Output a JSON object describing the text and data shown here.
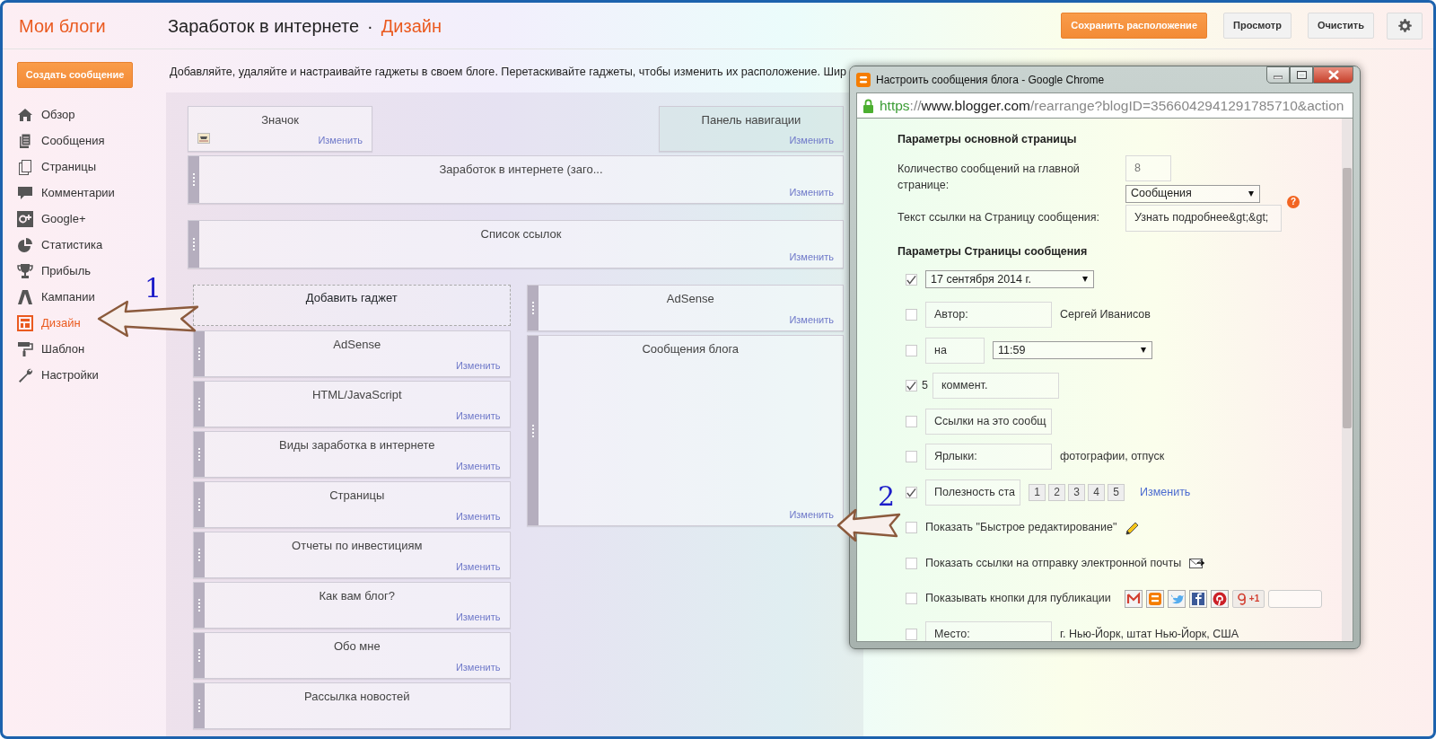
{
  "header": {
    "blogs_link": "Мои блоги",
    "blog_title": "Заработок в интернете",
    "separator": "·",
    "section": "Дизайн",
    "buttons": [
      {
        "label": "Сохранить расположение",
        "kind": "primary"
      },
      {
        "label": "Просмотр",
        "kind": "default"
      },
      {
        "label": "Очистить",
        "kind": "default"
      }
    ]
  },
  "sidebar": {
    "create_button": "Создать сообщение",
    "items": [
      {
        "label": "Обзор",
        "selected": false
      },
      {
        "label": "Сообщения",
        "selected": false
      },
      {
        "label": "Страницы",
        "selected": false
      },
      {
        "label": "Комментарии",
        "selected": false
      },
      {
        "label": "Google+",
        "selected": false
      },
      {
        "label": "Статистика",
        "selected": false
      },
      {
        "label": "Прибыль",
        "selected": false
      },
      {
        "label": "Кампании",
        "selected": false
      },
      {
        "label": "Дизайн",
        "selected": true
      },
      {
        "label": "Шаблон",
        "selected": false
      },
      {
        "label": "Настройки",
        "selected": false
      }
    ]
  },
  "description": "Добавляйте, удаляйте и настраивайте гаджеты в своем блоге. Перетаскивайте гаджеты, чтобы изменить их расположение. Шир",
  "layout": {
    "header_row": [
      {
        "title": "Значок",
        "edit": "Изменить",
        "kind": "favicon"
      },
      {
        "title": "Панель навигации",
        "edit": "Изменить",
        "kind": "navbar"
      }
    ],
    "wide": [
      {
        "title": "Заработок в интернете (заго...",
        "edit": "Изменить"
      },
      {
        "title": "Список ссылок",
        "edit": "Изменить"
      }
    ],
    "add_gadget": "Добавить гаджет",
    "left_column": [
      {
        "title": "AdSense",
        "edit": "Изменить"
      },
      {
        "title": "HTML/JavaScript",
        "edit": "Изменить"
      },
      {
        "title": "Виды заработка в интернете",
        "edit": "Изменить"
      },
      {
        "title": "Страницы",
        "edit": "Изменить"
      },
      {
        "title": "Отчеты по инвестициям",
        "edit": "Изменить"
      },
      {
        "title": "Как вам блог?",
        "edit": "Изменить"
      },
      {
        "title": "Обо мне",
        "edit": "Изменить"
      },
      {
        "title": "Рассылка новостей"
      }
    ],
    "right_column": [
      {
        "title": "AdSense",
        "edit": "Изменить",
        "kind": "short"
      },
      {
        "title": "Сообщения блога",
        "edit": "Изменить",
        "kind": "tall"
      }
    ]
  },
  "popup": {
    "title": "Настроить сообщения блога - Google Chrome",
    "url": [
      {
        "text": "https",
        "kind": "scheme"
      },
      {
        "text": "://",
        "kind": "path"
      },
      {
        "text": "www.blogger.com",
        "kind": "host"
      },
      {
        "text": "/rearrange?blogID=3566042941291785710&action",
        "kind": "path"
      }
    ],
    "main_heading": "Параметры основной страницы",
    "count_label": "Количество сообщений на главной странице:",
    "count_value": "8",
    "count_unit": "Сообщения",
    "link_label": "Текст ссылки на Страницу сообщения:",
    "link_value": "Узнать подробнее&gt;&gt;",
    "help": "?",
    "post_heading": "Параметры Страницы сообщения",
    "rows": [
      {
        "kind": "select",
        "checked": true,
        "value": "17 сентября 2014 г."
      },
      {
        "kind": "input",
        "checked": false,
        "value": "Автор:",
        "after": "Сергей Иванисов"
      },
      {
        "kind": "input_select",
        "checked": false,
        "value": "на",
        "select": "11:59"
      },
      {
        "kind": "prefix_input",
        "checked": true,
        "prefix": "5",
        "value": "коммент."
      },
      {
        "kind": "input",
        "checked": false,
        "value": "Ссылки на это сообщ"
      },
      {
        "kind": "input",
        "checked": false,
        "value": "Ярлыки:",
        "after": "фотографии, отпуск"
      },
      {
        "kind": "rating",
        "checked": true,
        "value": "Полезность ста",
        "options": [
          "1",
          "2",
          "3",
          "4",
          "5"
        ],
        "link": "Изменить"
      },
      {
        "kind": "quickedit",
        "checked": false,
        "label": "Показать \"Быстрое редактирование\""
      },
      {
        "kind": "email",
        "checked": false,
        "label": "Показать ссылки на отправку электронной почты"
      },
      {
        "kind": "share",
        "checked": false,
        "label": "Показывать кнопки для публикации",
        "plus_one": "+1"
      },
      {
        "kind": "input",
        "checked": false,
        "value": "Место:",
        "after": "г. Нью-Йорк, штат Нью-Йорк, США"
      }
    ]
  },
  "annotations": [
    {
      "number": "1"
    },
    {
      "number": "2"
    }
  ]
}
